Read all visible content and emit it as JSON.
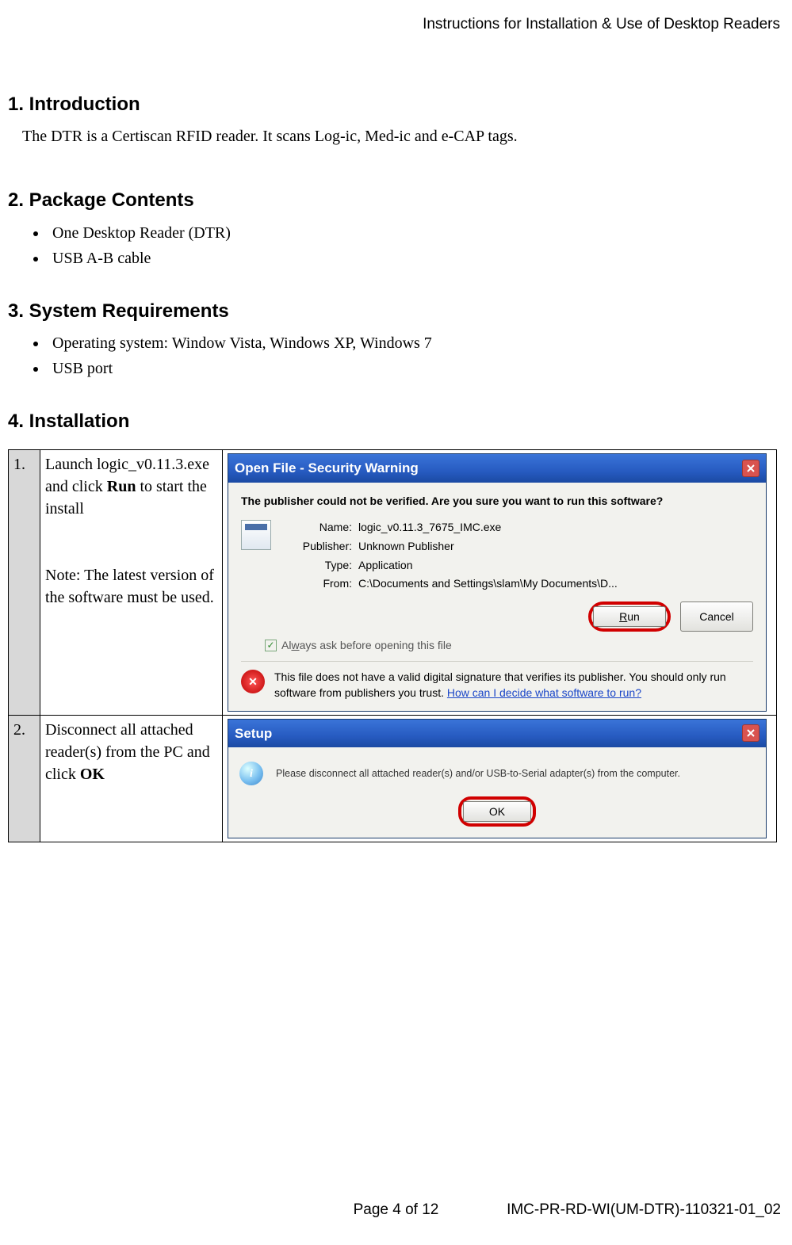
{
  "header": {
    "doc_title": "Instructions for Installation & Use of Desktop Readers"
  },
  "sections": {
    "intro": {
      "heading": "1. Introduction",
      "text": "The DTR is a Certiscan RFID reader. It scans Log-ic, Med-ic and e-CAP tags."
    },
    "package": {
      "heading": "2. Package Contents",
      "items": [
        "One Desktop Reader (DTR)",
        "USB A-B cable"
      ]
    },
    "sysreq": {
      "heading": "3. System Requirements",
      "items": [
        "Operating system: Window Vista, Windows XP, Windows 7",
        "USB port"
      ]
    },
    "install": {
      "heading": "4. Installation"
    }
  },
  "steps": [
    {
      "num": "1.",
      "desc_pre": "Launch logic_v0.11.3.exe and click ",
      "desc_bold": "Run",
      "desc_post": " to start the install",
      "desc_note": "Note: The latest version of the software must be used."
    },
    {
      "num": "2.",
      "desc_pre": "Disconnect all attached reader(s) from the PC and click ",
      "desc_bold": "OK",
      "desc_post": ""
    }
  ],
  "dialog1": {
    "title": "Open File - Security Warning",
    "question": "The publisher could not be verified.  Are you sure you want to run this software?",
    "kv": {
      "name_label": "Name:",
      "name_value": "logic_v0.11.3_7675_IMC.exe",
      "publisher_label": "Publisher:",
      "publisher_value": "Unknown Publisher",
      "type_label": "Type:",
      "type_value": "Application",
      "from_label": "From:",
      "from_value": "C:\\Documents and Settings\\slam\\My Documents\\D..."
    },
    "btn_run": "Run",
    "btn_cancel": "Cancel",
    "checkbox_label": "Always ask before opening this file",
    "warning_text": "This file does not have a valid digital signature that verifies its publisher.  You should only run software from publishers you trust.",
    "warning_link": "How can I decide what software to run?"
  },
  "dialog2": {
    "title": "Setup",
    "message": "Please disconnect all attached reader(s) and/or USB-to-Serial adapter(s) from the computer.",
    "btn_ok": "OK"
  },
  "footer": {
    "page": "Page 4 of 12",
    "doc_code": "IMC-PR-RD-WI(UM-DTR)-110321-01_02"
  }
}
